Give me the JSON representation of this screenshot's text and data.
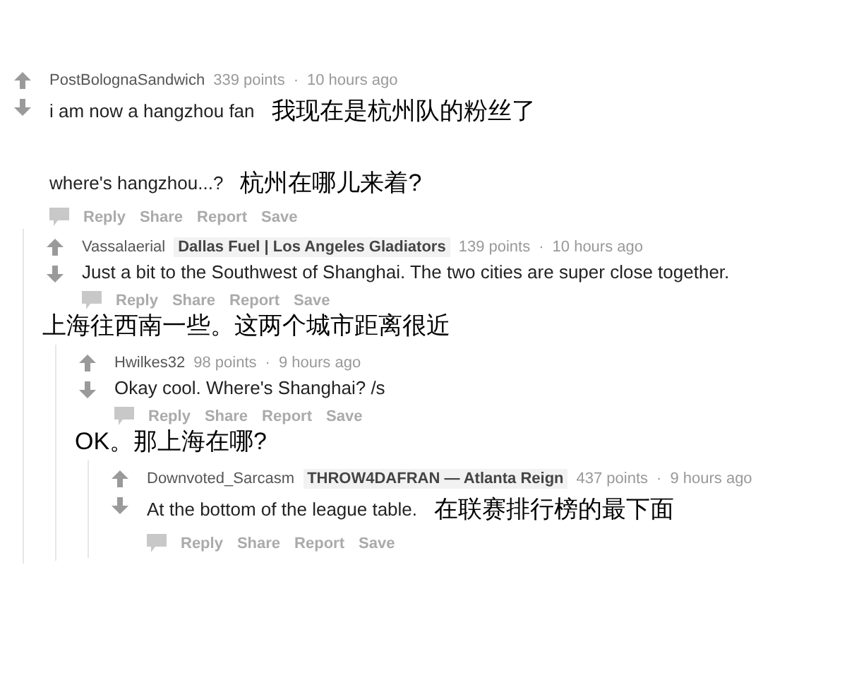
{
  "comments": [
    {
      "author": "PostBolognaSandwich",
      "points": "339 points",
      "separator": "·",
      "time": "10 hours ago",
      "blocks": [
        {
          "kind": "body",
          "text": "i am now a hangzhou fan",
          "note": "我现在是杭州队的粉丝了"
        },
        {
          "kind": "body",
          "text": "where's hangzhou...?",
          "note": "杭州在哪儿来着?"
        },
        {
          "kind": "actions",
          "items": [
            "Reply",
            "Share",
            "Report",
            "Save"
          ]
        }
      ],
      "children": [
        {
          "author": "Vassalaerial",
          "flair": "Dallas Fuel | Los Angeles Gladiators",
          "points": "139 points",
          "separator": "·",
          "time": "10 hours ago",
          "blocks": [
            {
              "kind": "body",
              "text": "Just a bit to the Southwest of Shanghai. The two cities are super close together."
            },
            {
              "kind": "actions",
              "items": [
                "Reply",
                "Share",
                "Report",
                "Save"
              ]
            },
            {
              "kind": "note",
              "text": "上海往西南一些。这两个城市距离很近"
            }
          ],
          "children": [
            {
              "author": "Hwilkes32",
              "points": "98 points",
              "separator": "·",
              "time": "9 hours ago",
              "blocks": [
                {
                  "kind": "body",
                  "text": "Okay cool. Where's Shanghai? /s"
                },
                {
                  "kind": "actions",
                  "items": [
                    "Reply",
                    "Share",
                    "Report",
                    "Save"
                  ]
                },
                {
                  "kind": "note",
                  "text": "OK。那上海在哪?"
                }
              ],
              "children": [
                {
                  "author": "Downvoted_Sarcasm",
                  "flair": "THROW4DAFRAN — Atlanta Reign",
                  "points": "437 points",
                  "separator": "·",
                  "time": "9 hours ago",
                  "blocks": [
                    {
                      "kind": "body",
                      "text": "At the bottom of the league table.",
                      "note": "在联赛排行榜的最下面"
                    },
                    {
                      "kind": "actions",
                      "items": [
                        "Reply",
                        "Share",
                        "Report",
                        "Save"
                      ]
                    }
                  ]
                }
              ]
            }
          ]
        }
      ]
    }
  ]
}
